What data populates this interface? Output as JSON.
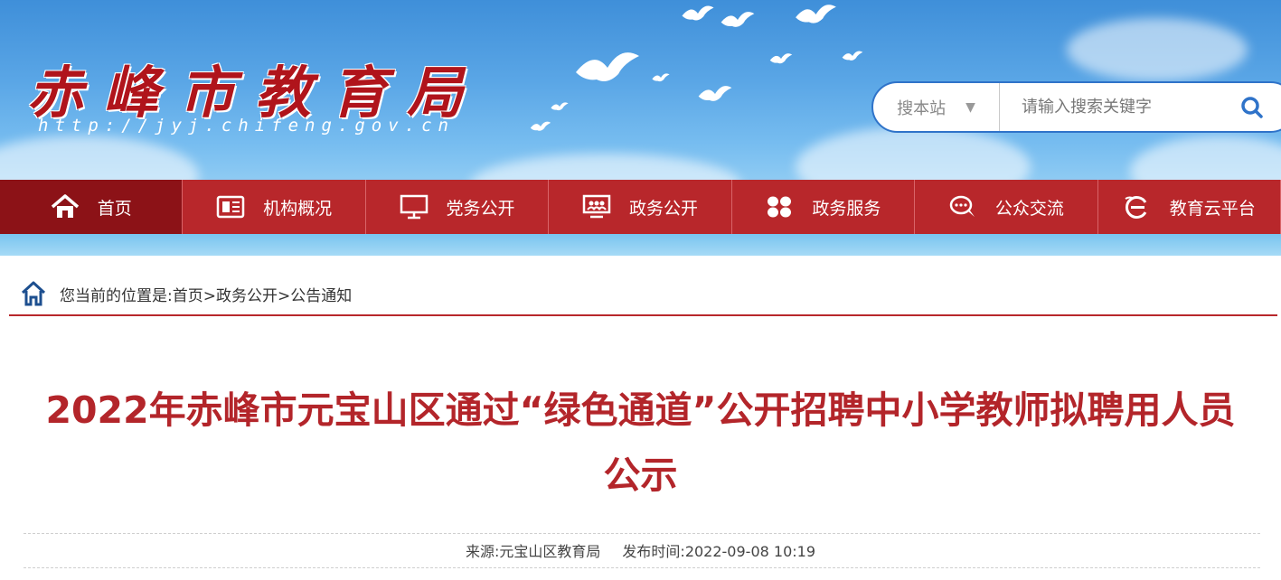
{
  "header": {
    "site_title": "赤峰市教育局",
    "site_url": "http://jyj.chifeng.gov.cn"
  },
  "search": {
    "scope_label": "搜本站",
    "placeholder": "请输入搜索关键字"
  },
  "nav": {
    "items": [
      {
        "label": "首页",
        "icon": "home-icon"
      },
      {
        "label": "机构概况",
        "icon": "document-icon"
      },
      {
        "label": "党务公开",
        "icon": "monitor-icon"
      },
      {
        "label": "政务公开",
        "icon": "presentation-icon"
      },
      {
        "label": "政务服务",
        "icon": "grid-icon"
      },
      {
        "label": "公众交流",
        "icon": "chat-icon"
      },
      {
        "label": "教育云平台",
        "icon": "cloud-e-icon"
      }
    ]
  },
  "breadcrumb": {
    "prefix": "您当前的位置是:",
    "items": [
      "首页",
      "政务公开",
      "公告通知"
    ],
    "separator": ">"
  },
  "article": {
    "title_line1": "2022年赤峰市元宝山区通过“绿色通道”公开招聘中小学教师拟聘用人员",
    "title_line2": "公示",
    "source_label": "来源:",
    "source": "元宝山区教育局",
    "time_label": "发布时间:",
    "time": "2022-09-08 10:19"
  },
  "colors": {
    "nav_red": "#b8272b",
    "nav_active": "#8c1217",
    "title_red": "#b3252a",
    "search_border": "#2f73c9"
  }
}
